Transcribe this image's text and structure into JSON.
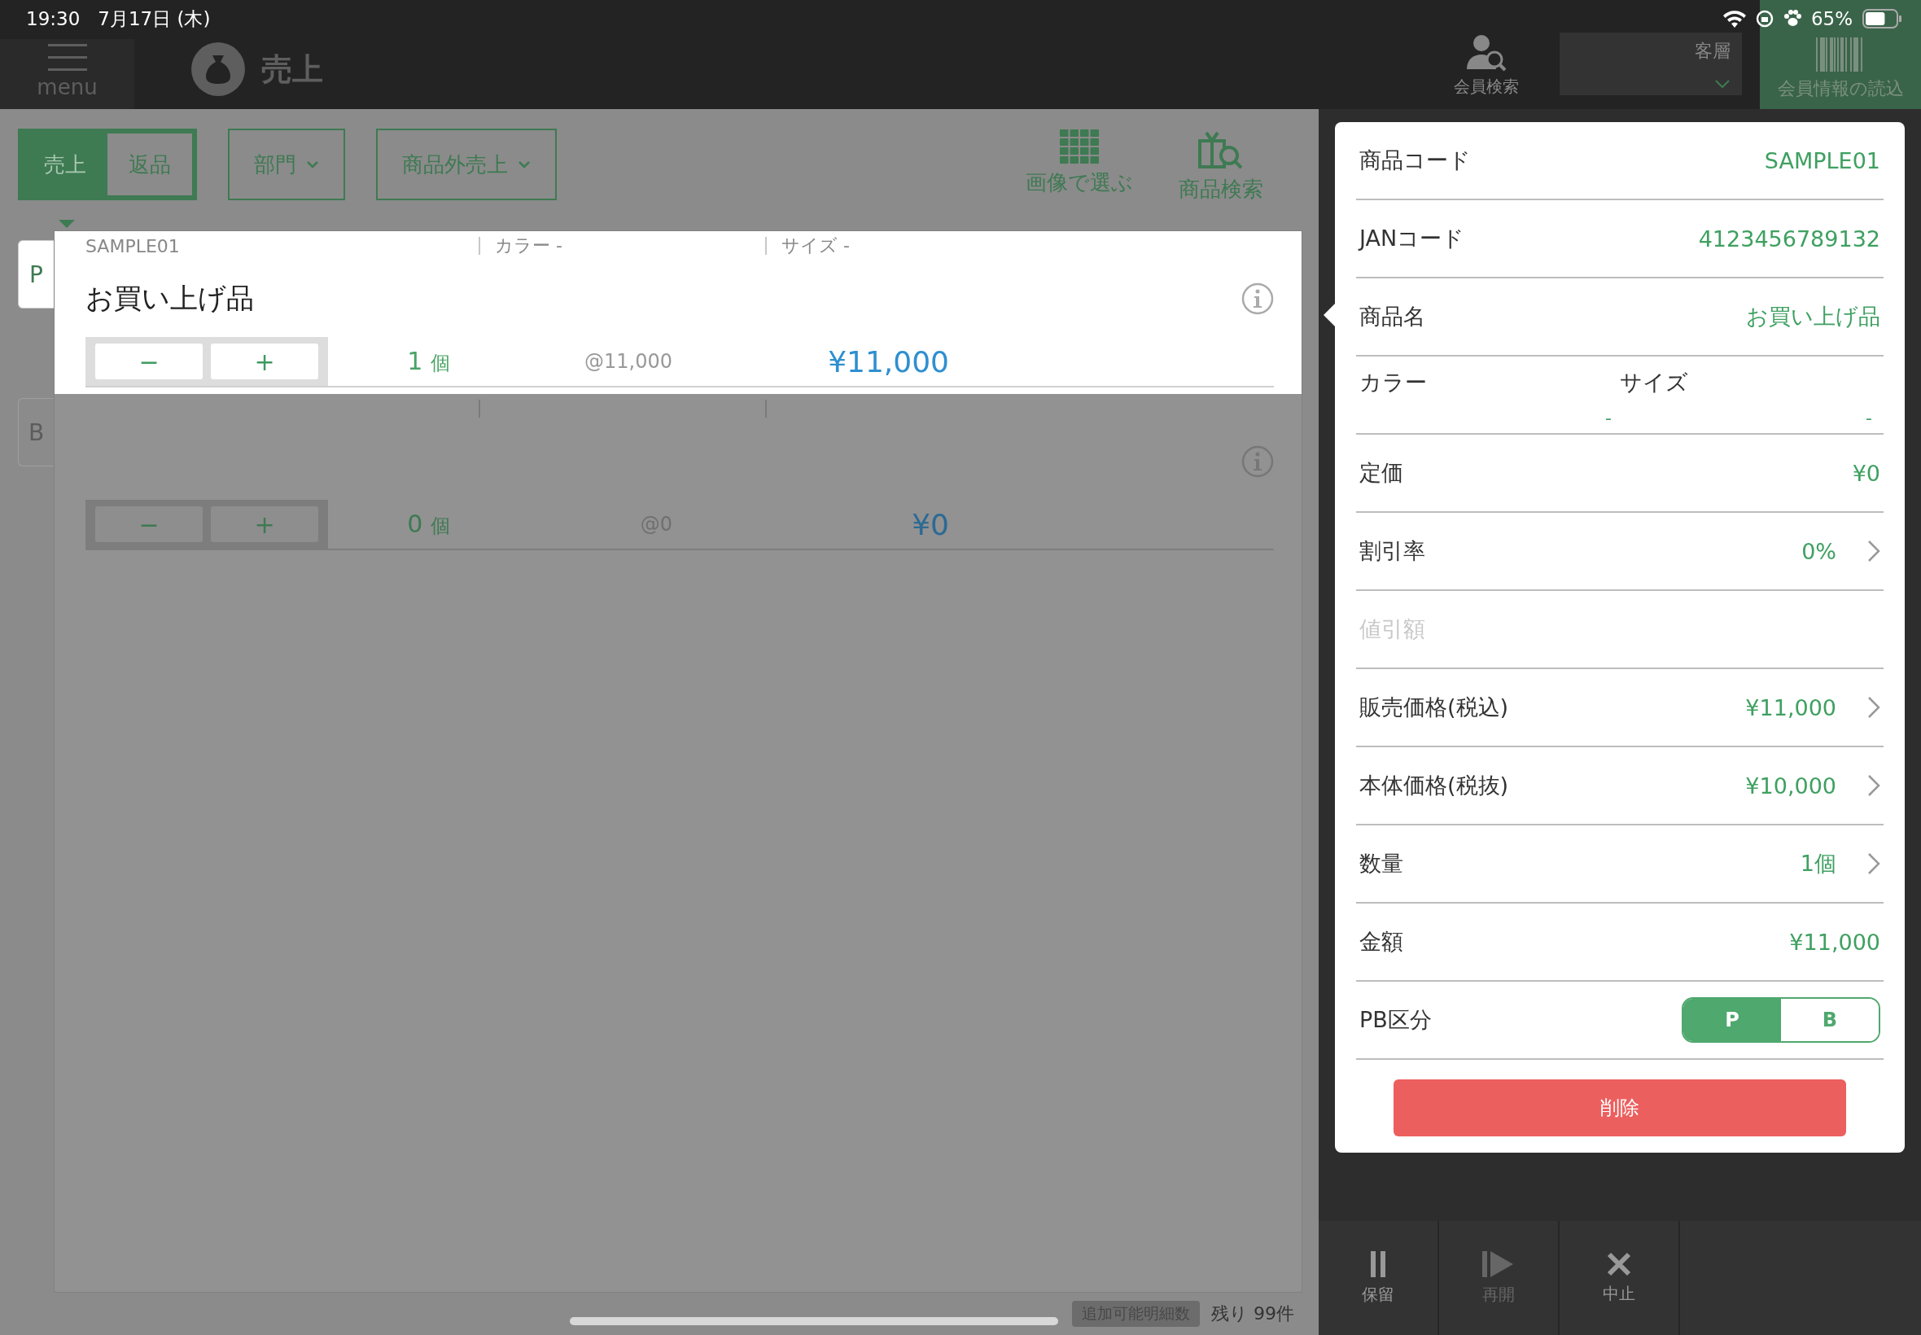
{
  "status_bar": {
    "time": "19:30",
    "date": "7月17日 (木)",
    "battery": "65%"
  },
  "header": {
    "menu_label": "menu",
    "title": "売上",
    "member_search": "会員検索",
    "customer_segment": "客層",
    "member_read": "会員情報の読込"
  },
  "mode_tabs": [
    {
      "label": "売上",
      "selected": true
    },
    {
      "label": "返品",
      "selected": false
    }
  ],
  "dropdowns": [
    "部門",
    "商品外売上"
  ],
  "tools": [
    {
      "label": "画像で選ぶ",
      "kind": "grid"
    },
    {
      "label": "商品検索",
      "kind": "search"
    }
  ],
  "pb_tabs": [
    {
      "label": "P",
      "selected": true
    },
    {
      "label": "B",
      "selected": false
    }
  ],
  "line_items": [
    {
      "code": "SAMPLE01",
      "color_label": "カラー -",
      "size_label": "サイズ -",
      "name": "お買い上げ品",
      "minus": "−",
      "plus": "+",
      "qty": "1",
      "unit": "個",
      "unit_price": "@11,000",
      "amount": "¥11,000",
      "selected": true
    },
    {
      "minus": "−",
      "plus": "+",
      "qty": "0",
      "unit": "個",
      "unit_price": "@0",
      "amount": "¥0",
      "selected": false
    }
  ],
  "footer": {
    "badge": "追加可能明細数",
    "remaining": "残り 99件"
  },
  "detail": {
    "rows": [
      {
        "kind": "value",
        "label": "商品コード",
        "value": "SAMPLE01"
      },
      {
        "kind": "value",
        "label": "JANコード",
        "value": "4123456789132"
      },
      {
        "kind": "value",
        "label": "商品名",
        "value": "お買い上げ品"
      },
      {
        "kind": "pair",
        "label": "カラー",
        "value": "-",
        "label2": "サイズ",
        "value2": "-"
      },
      {
        "kind": "value",
        "label": "定価",
        "value": "¥0"
      },
      {
        "kind": "chevron",
        "label": "割引率",
        "value": "0%"
      },
      {
        "kind": "disabled",
        "label": "値引額"
      },
      {
        "kind": "chevron",
        "label": "販売価格(税込)",
        "value": "¥11,000"
      },
      {
        "kind": "chevron",
        "label": "本体価格(税抜)",
        "value": "¥10,000"
      },
      {
        "kind": "chevron",
        "label": "数量",
        "value": "1個"
      },
      {
        "kind": "value",
        "label": "金額",
        "value": "¥11,000"
      },
      {
        "kind": "toggle",
        "label": "PB区分",
        "options": [
          {
            "label": "P",
            "selected": true
          },
          {
            "label": "B",
            "selected": false
          }
        ]
      }
    ],
    "delete_button": "削除"
  },
  "actions": [
    {
      "label": "保留",
      "kind": "pause",
      "disabled": false
    },
    {
      "label": "再開",
      "kind": "resume",
      "disabled": true
    },
    {
      "label": "中止",
      "kind": "cancel",
      "disabled": false
    }
  ]
}
